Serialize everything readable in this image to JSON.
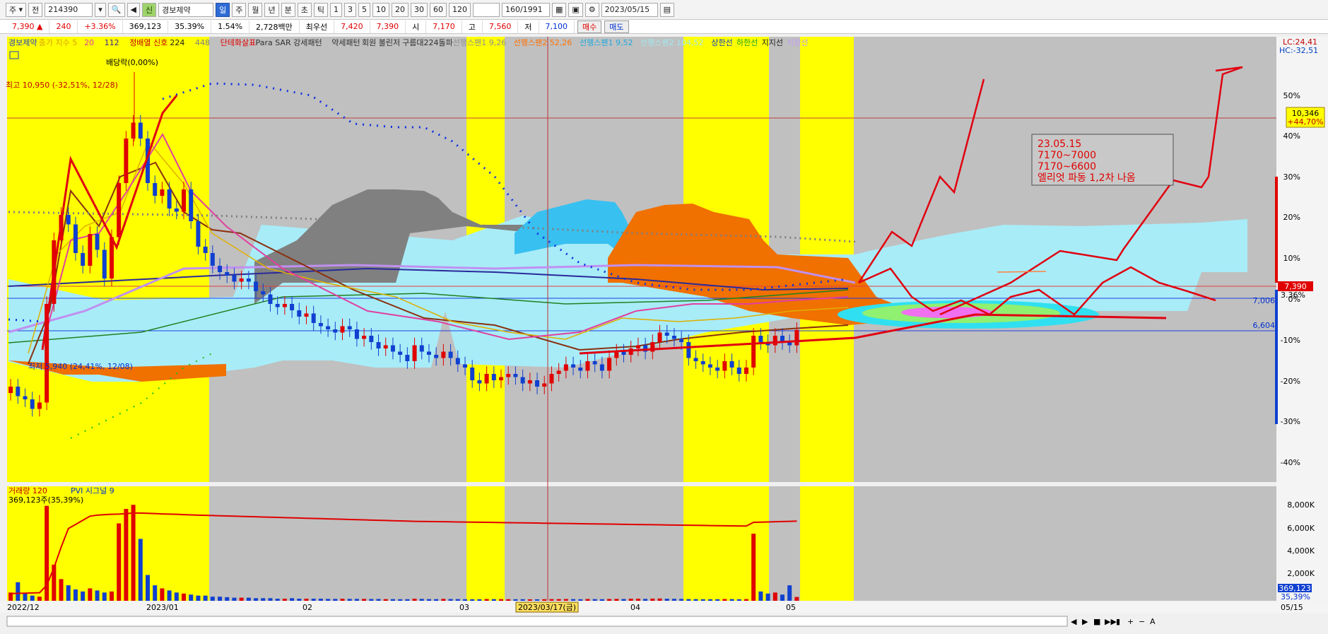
{
  "toolbar": {
    "period_type": "주",
    "range": "전",
    "code": "214390",
    "name": "경보제약",
    "credit": "신",
    "intervals": [
      "일",
      "주",
      "월",
      "년",
      "분",
      "초",
      "틱"
    ],
    "numbers": [
      "1",
      "3",
      "5",
      "10",
      "20",
      "30",
      "60",
      "120"
    ],
    "count": "160/1991",
    "date": "2023/05/15"
  },
  "quote": {
    "price": "7,390 ▲",
    "change": "240",
    "change_pct": "+3.36%",
    "volume": "369,123",
    "turnover_pct": "35.39%",
    "vol_ratio": "1.54%",
    "amount": "2,728백만",
    "preferred_label": "최우선",
    "best": "7,420",
    "best2": "7,390",
    "open_label": "시",
    "open": "7,170",
    "high_label": "고",
    "high": "7,560",
    "low_label": "저",
    "low": "7,100",
    "buy": "매수",
    "sell": "매도"
  },
  "legend": [
    {
      "text": "경보제약",
      "color": "#2040c0"
    },
    {
      "text": "종가 지수 5",
      "color": "#d8a000"
    },
    {
      "text": "20",
      "color": "#e040a0"
    },
    {
      "text": "112",
      "color": "#402090"
    },
    {
      "text": "정배열 신호",
      "color": "#c00000"
    },
    {
      "text": "224",
      "color": "#202020"
    },
    {
      "text": "448",
      "color": "#808080"
    },
    {
      "text": "단테화살표",
      "color": "#e00000"
    },
    {
      "text": "Para SAR 강세패턴",
      "color": "#303030"
    },
    {
      "text": "약세패턴",
      "color": "#303030"
    },
    {
      "text": "회원 볼린저",
      "color": "#303030"
    },
    {
      "text": "구름대224돌파",
      "color": "#303030"
    },
    {
      "text": "선행스팬1 9,26",
      "color": "#909090"
    },
    {
      "text": "선행스팬2 52,26",
      "color": "#ff7000"
    },
    {
      "text": "선행스팬1 9,52",
      "color": "#20a8e0"
    },
    {
      "text": "선행스팬2 104,52",
      "color": "#a0e8f0"
    },
    {
      "text": "상한선",
      "color": "#1040c0"
    },
    {
      "text": "하한선",
      "color": "#20a020"
    },
    {
      "text": "지지선",
      "color": "#202020"
    },
    {
      "text": "저항선",
      "color": "#c0a0f0"
    }
  ],
  "labels": {
    "high_note": "최고 10,950 (-32,51%, 12/28)",
    "low_note": "최저 5,940 (24,41%, 12/08)",
    "dividend": "배당락(0,00%)",
    "lc": "LC:24,41",
    "hc": "HC:-32,51",
    "last_price_tag": "7,390",
    "last_pct_tag": "3.36%",
    "ref_price": "10,346",
    "ref_pct": "+44,70%",
    "line_7006": "7,006",
    "line_6604": "6,604",
    "volume_title": "거래량 120",
    "pvi_title": "PVI 시그널 9",
    "volume_note": "369,123주(35,39%)",
    "volume_tag": "369,123",
    "volume_pct_tag": "35,39%",
    "cursor_date": "2023/03/17(금)"
  },
  "annotation": {
    "lines": [
      "23.05.15",
      "7170~7000",
      "7170~6600",
      "엘리엇 파동 1,2차 나옴"
    ]
  },
  "colors": {
    "up": "#e00000",
    "down": "#1040d0",
    "yellow_band": "#ffff00",
    "gray_band": "#c0c0c0",
    "cloud_cyan": "#a8ecf8",
    "cloud_orange": "#f07000",
    "cloud_gray": "#808080"
  },
  "chart_data": {
    "type": "candlestick",
    "x": [
      "12/05",
      "12/06",
      "12/07",
      "12/08",
      "12/09",
      "12/12",
      "12/13",
      "12/14",
      "12/15",
      "12/16",
      "12/19",
      "12/20",
      "12/21",
      "12/22",
      "12/23",
      "12/26",
      "12/27",
      "12/28",
      "12/29",
      "01/02",
      "01/03",
      "01/04",
      "01/05",
      "01/06",
      "01/09",
      "01/10",
      "01/11",
      "01/12",
      "01/13",
      "01/16",
      "01/17",
      "01/18",
      "01/19",
      "01/20",
      "01/25",
      "01/26",
      "01/27",
      "01/30",
      "01/31",
      "02/01",
      "02/02",
      "02/03",
      "02/06",
      "02/07",
      "02/08",
      "02/09",
      "02/10",
      "02/13",
      "02/14",
      "02/15",
      "02/16",
      "02/17",
      "02/20",
      "02/21",
      "02/22",
      "02/23",
      "02/24",
      "02/27",
      "02/28",
      "03/02",
      "03/03",
      "03/06",
      "03/07",
      "03/08",
      "03/09",
      "03/10",
      "03/13",
      "03/14",
      "03/15",
      "03/16",
      "03/17",
      "03/20",
      "03/21",
      "03/22",
      "03/23",
      "03/24",
      "03/27",
      "03/28",
      "03/29",
      "03/30",
      "03/31",
      "04/03",
      "04/04",
      "04/05",
      "04/06",
      "04/07",
      "04/10",
      "04/11",
      "04/12",
      "04/13",
      "04/14",
      "04/17",
      "04/18",
      "04/19",
      "04/20",
      "04/21",
      "04/24",
      "04/25",
      "04/26",
      "04/27",
      "04/28",
      "05/02",
      "05/03",
      "05/04",
      "05/08",
      "05/09",
      "05/10",
      "05/11",
      "05/12",
      "05/15"
    ],
    "close": [
      6500,
      6350,
      6300,
      6150,
      6250,
      7800,
      8800,
      9200,
      9050,
      8600,
      8400,
      8900,
      8650,
      8200,
      8850,
      9700,
      10400,
      10650,
      10400,
      9700,
      9500,
      9600,
      9300,
      9250,
      9600,
      9100,
      8700,
      8600,
      8400,
      8300,
      8250,
      8150,
      8200,
      8150,
      8000,
      7950,
      7800,
      7750,
      7800,
      7700,
      7600,
      7650,
      7500,
      7450,
      7400,
      7350,
      7450,
      7400,
      7250,
      7300,
      7200,
      7100,
      7150,
      7050,
      7000,
      6900,
      7150,
      7050,
      7000,
      6950,
      7050,
      6950,
      6850,
      6800,
      6600,
      6550,
      6700,
      6600,
      6650,
      6700,
      6650,
      6550,
      6600,
      6500,
      6550,
      6700,
      6750,
      6850,
      6800,
      6750,
      6900,
      6850,
      6750,
      6950,
      7050,
      7000,
      7100,
      7150,
      7050,
      7200,
      7350,
      7300,
      7250,
      7200,
      6950,
      6900,
      6850,
      6800,
      6750,
      6900,
      6800,
      6700,
      6800,
      7300,
      7200,
      7150,
      7300,
      7200,
      7150,
      7390
    ],
    "volume_labels": [
      "2,000K",
      "4,000K",
      "6,000K",
      "8,000K"
    ],
    "y_ticks_pct": [
      "50%",
      "40%",
      "30%",
      "20%",
      "10%",
      "0%",
      "-10%",
      "-20%",
      "-30%",
      "-40%"
    ],
    "volume_ticks": [
      "8,000K",
      "6,000K",
      "4,000K",
      "2,000K"
    ],
    "x_labels": [
      "2022/12",
      "2023/01",
      "02",
      "03",
      "04",
      "05",
      "05/15"
    ],
    "volume": [
      800,
      1800,
      700,
      500,
      400,
      9200,
      3500,
      2100,
      1500,
      1100,
      900,
      1200,
      1000,
      800,
      900,
      7500,
      8900,
      9300,
      6000,
      2500,
      1500,
      1200,
      1000,
      800,
      700,
      600,
      500,
      500,
      400,
      400,
      350,
      300,
      300,
      300,
      250,
      250,
      250,
      200,
      200,
      250,
      200,
      200,
      200,
      200,
      180,
      180,
      200,
      180,
      180,
      180,
      170,
      170,
      160,
      160,
      150,
      150,
      200,
      180,
      160,
      160,
      180,
      170,
      160,
      150,
      150,
      150,
      170,
      160,
      160,
      150,
      150,
      150,
      140,
      140,
      150,
      160,
      160,
      170,
      160,
      150,
      170,
      160,
      150,
      170,
      180,
      170,
      200,
      200,
      180,
      210,
      220,
      200,
      190,
      180,
      160,
      160,
      150,
      150,
      150,
      170,
      160,
      150,
      160,
      6500,
      900,
      700,
      800,
      600,
      1500,
      369
    ],
    "pvi": [
      700,
      720,
      740,
      760,
      780,
      1500,
      3200,
      5200,
      7000,
      7400,
      7800,
      8200,
      8300,
      8350,
      8380,
      8400,
      8450,
      8500,
      8500,
      8480,
      8450,
      8420,
      8400,
      8380,
      8350,
      8320,
      8300,
      8280,
      8260,
      8240,
      8220,
      8200,
      8180,
      8160,
      8140,
      8120,
      8100,
      8080,
      8060,
      8040,
      8020,
      8000,
      7980,
      7960,
      7940,
      7920,
      7900,
      7880,
      7860,
      7840,
      7820,
      7800,
      7780,
      7760,
      7740,
      7720,
      7700,
      7690,
      7680,
      7670,
      7660,
      7650,
      7640,
      7630,
      7620,
      7610,
      7600,
      7590,
      7580,
      7570,
      7560,
      7550,
      7540,
      7530,
      7520,
      7510,
      7500,
      7490,
      7480,
      7470,
      7460,
      7450,
      7440,
      7430,
      7420,
      7410,
      7400,
      7390,
      7380,
      7370,
      7360,
      7350,
      7340,
      7330,
      7320,
      7310,
      7300,
      7290,
      7280,
      7270,
      7260,
      7250,
      7240,
      7600,
      7620,
      7640,
      7660,
      7680,
      7700,
      7720
    ]
  }
}
